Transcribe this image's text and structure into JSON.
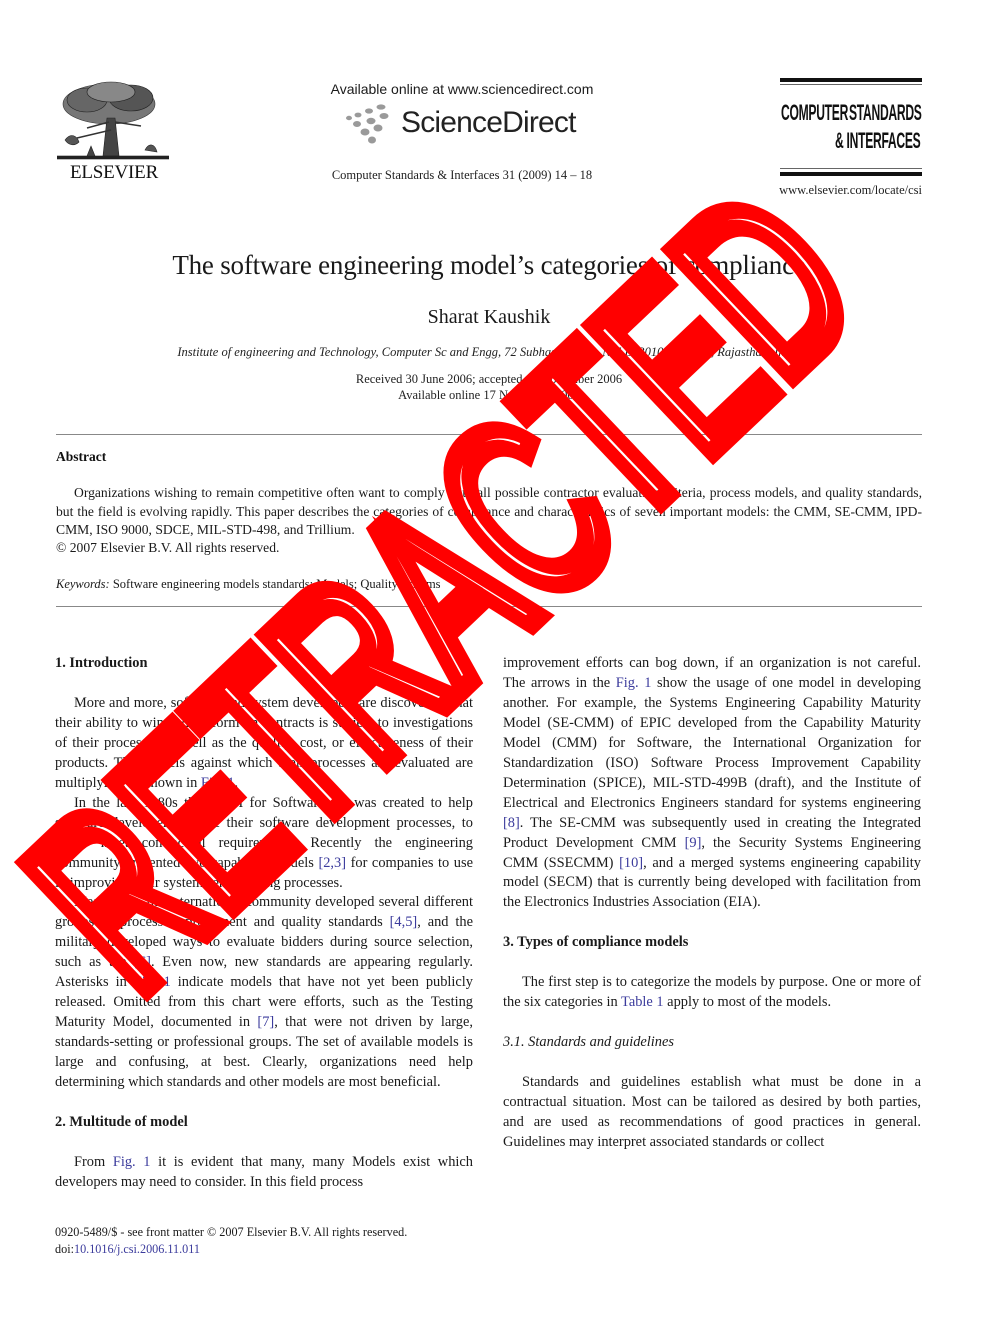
{
  "header": {
    "publisher": "ELSEVIER",
    "available_online": "Available online at www.sciencedirect.com",
    "platform": "ScienceDirect",
    "journal_citation": "Computer Standards & Interfaces 31 (2009) 14 – 18",
    "journal_logo_line1_a": "COMPUTER",
    "journal_logo_line1_b": "STANDARDS",
    "journal_logo_line2": "& INTERFACES",
    "journal_url": "www.elsevier.com/locate/csi"
  },
  "article": {
    "title": "The software engineering model’s categories of compliance",
    "author": "Sharat Kaushik",
    "affiliation": "Institute of engineering and Technology, Computer Sc and Engg, 72 Subhash Nagar, N E B, 301030, Alwar, Rajasthan, India",
    "received": "Received 30 June 2006; accepted 12 November 2006",
    "available": "Available online 17 November 2007"
  },
  "abstract": {
    "heading": "Abstract",
    "body": "Organizations wishing to remain competitive often want to comply with all possible contractor evaluation criteria, process models, and quality standards, but the field is evolving rapidly. This paper describes the categories of compliance and characteristics of seven important models: the CMM, SE-CMM, IPD-CMM, ISO 9000, SDCE, MIL-STD-498, and Trillium.",
    "copyright": "© 2007 Elsevier B.V. All rights reserved.",
    "keywords_label": "Keywords:",
    "keywords": "Software engineering models standards; Models; Quality systems"
  },
  "body": {
    "sec1_heading": "1. Introduction",
    "sec1_p1": {
      "text": "More and more, software and system developers are discovering that their ability to win and perform on contracts is subject to investigations of their processes as well as the quality, cost, or effectiveness of their products. The Models against which their processes are evaluated are multiplying, as shown in ",
      "link": "Fig. 1",
      "end": "."
    },
    "sec1_p2": {
      "a": "In the late 1980s the CMM for Software ",
      "ref1": "[1]",
      "b": " was created to help software developers mature their software development processes, to better meet contractual requirements. Recently the engineering community presented two capability models ",
      "ref2": "[2,3]",
      "c": " for companies to use in improving their systems engineering processes."
    },
    "sec1_p3": {
      "a": "Meanwhile, the international community developed several different groups of process improvement and quality standards ",
      "ref1": "[4,5]",
      "b": ", and the military developed ways to evaluate bidders during source selection, such as the ",
      "ref2": "[6]",
      "c": ". Even now, new standards are appearing regularly. Asterisks in ",
      "ref3": "Fig. 1",
      "d": " indicate models that have not yet been publicly released. Omitted from this chart were efforts, such as the Testing Maturity Model, documented in ",
      "ref4": "[7]",
      "e": ", that were not driven by large, standards-setting or professional groups. The set of available models is large and confusing, at best. Clearly, organizations need help determining which standards and other models are most beneficial."
    },
    "sec2_heading": "2. Multitude of model",
    "sec2_p1": {
      "a": "From ",
      "ref1": "Fig. 1",
      "b": " it is evident that many, many Models exist which developers may need to consider. In this field process"
    },
    "right_p1": {
      "a": "improvement efforts can bog down, if an organization is not careful. The arrows in the ",
      "ref1": "Fig. 1",
      "b": " show the usage of one model in developing another. For example, the Systems Engineering Capability Maturity Model (SE-CMM) of EPIC developed from the Capability Maturity Model (CMM) for Software, the International Organization for Standardization (ISO) Software Process Improvement Capability Determination (SPICE), MIL-STD-499B (draft), and the Institute of Electrical and Electronics Engineers standard for systems engineering ",
      "ref2": "[8]",
      "c": ". The SE-CMM was subsequently used in creating the Integrated Product Development CMM ",
      "ref3": "[9]",
      "d": ", the Security Systems Engineering CMM (SSECMM) ",
      "ref4": "[10]",
      "e": ", and a merged systems engineering capability model (SECM) that is currently being developed with facilitation from the Electronics Industries Association (EIA)."
    },
    "sec3_heading": "3. Types of compliance models",
    "sec3_p1": {
      "a": "The first step is to categorize the models by purpose. One or more of the six categories in ",
      "ref1": "Table 1",
      "b": " apply to most of the models."
    },
    "sec31_heading": "3.1. Standards and guidelines",
    "sec31_p1": "Standards and guidelines establish what must be done in a contractual situation. Most can be tailored as desired by both parties, and are used as recommendations of good practices in general. Guidelines may interpret associated standards or collect"
  },
  "footer": {
    "issn_line": "0920-5489/$ - see front matter © 2007 Elsevier B.V. All rights reserved.",
    "doi_label": "doi:",
    "doi": "10.1016/j.csi.2006.11.011"
  },
  "watermark": {
    "text": "RETRACTED",
    "color": "#ff0000"
  },
  "colors": {
    "link": "#3b3b9c",
    "text": "#1a1a1a"
  }
}
